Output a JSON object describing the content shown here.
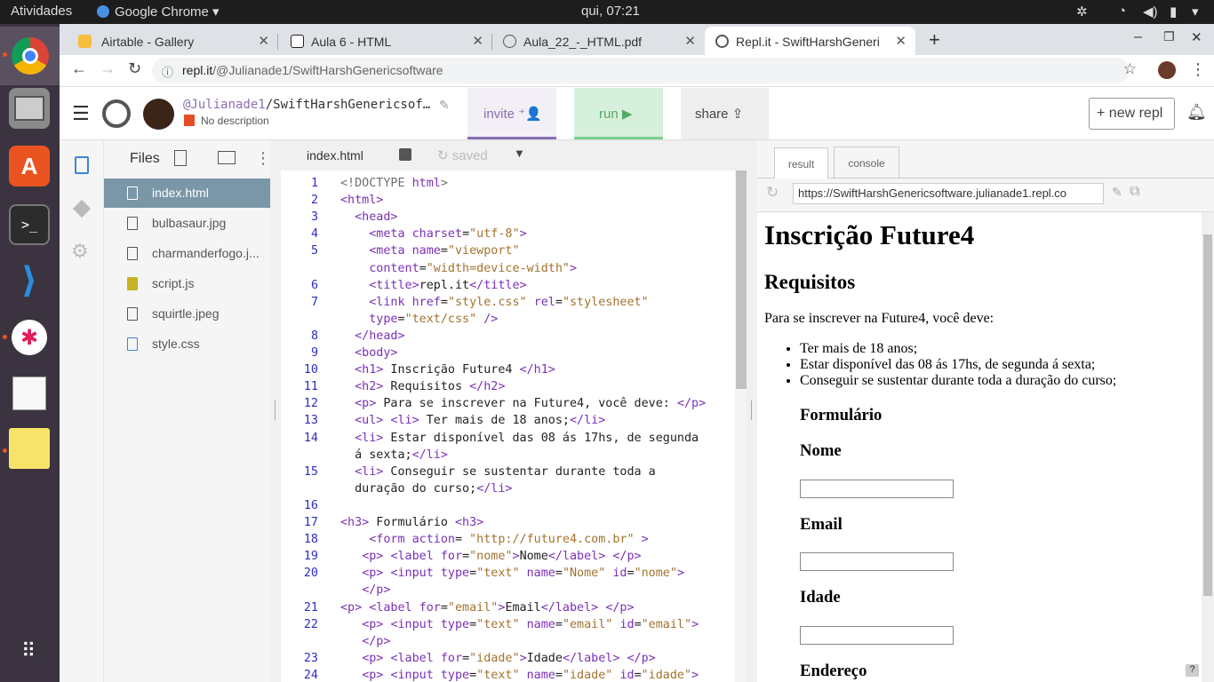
{
  "os": {
    "activities": "Atividades",
    "app_menu": "Google Chrome",
    "clock": "qui, 07:21"
  },
  "browser": {
    "tabs": [
      {
        "label": "Airtable - Gallery",
        "color": "#f7bd3d"
      },
      {
        "label": "Aula 6 - HTML",
        "color": "#222"
      },
      {
        "label": "Aula_22_-_HTML.pdf",
        "color": "#555"
      },
      {
        "label": "Repl.it - SwiftHarshGeneri",
        "color": "#555"
      }
    ],
    "close": "✕",
    "new_tab": "+",
    "url_host": "repl.it",
    "url_path": "/@Julianade1/SwiftHarshGenericsoftware"
  },
  "repl": {
    "user": "@Julianade1",
    "project_name": "/SwiftHarshGenericsof…",
    "description": "No description",
    "invite": "invite",
    "run": "run",
    "share": "share",
    "new_repl": "new repl"
  },
  "files": {
    "title": "Files",
    "items": [
      "index.html",
      "bulbasaur.jpg",
      "charmanderfogo.j...",
      "script.js",
      "squirtle.jpeg",
      "style.css"
    ]
  },
  "editor": {
    "tab": "index.html",
    "status": "saved"
  },
  "code": [
    {
      "n": "1",
      "h": "<span class=\"d\">&lt;!DOCTYPE</span> <span class=\"t\">html</span><span class=\"d\">&gt;</span>"
    },
    {
      "n": "2",
      "h": "<span class=\"t\">&lt;html&gt;</span>"
    },
    {
      "n": "3",
      "h": "  <span class=\"t\">&lt;head&gt;</span>"
    },
    {
      "n": "4",
      "h": "    <span class=\"t\">&lt;meta</span> <span class=\"a\">charset</span>=<span class=\"s\">\"utf-8\"</span><span class=\"t\">&gt;</span>"
    },
    {
      "n": "5",
      "h": "    <span class=\"t\">&lt;meta</span> <span class=\"a\">name</span>=<span class=\"s\">\"viewport\"</span>"
    },
    {
      "n": "",
      "h": "    <span class=\"a\">content</span>=<span class=\"s\">\"width=device-width\"</span><span class=\"t\">&gt;</span>"
    },
    {
      "n": "6",
      "h": "    <span class=\"t\">&lt;title&gt;</span>repl.it<span class=\"t\">&lt;/title&gt;</span>"
    },
    {
      "n": "7",
      "h": "    <span class=\"t\">&lt;link</span> <span class=\"a\">href</span>=<span class=\"s\">\"style.css\"</span> <span class=\"a\">rel</span>=<span class=\"s\">\"stylesheet\"</span>"
    },
    {
      "n": "",
      "h": "    <span class=\"a\">type</span>=<span class=\"s\">\"text/css\"</span> <span class=\"t\">/&gt;</span>"
    },
    {
      "n": "8",
      "h": "  <span class=\"t\">&lt;/head&gt;</span>"
    },
    {
      "n": "9",
      "h": "  <span class=\"t\">&lt;body&gt;</span>"
    },
    {
      "n": "10",
      "h": "  <span class=\"t\">&lt;h1&gt;</span> Inscrição Future4 <span class=\"t\">&lt;/h1&gt;</span>"
    },
    {
      "n": "11",
      "h": "  <span class=\"t\">&lt;h2&gt;</span> Requisitos <span class=\"t\">&lt;/h2&gt;</span>"
    },
    {
      "n": "12",
      "h": "  <span class=\"t\">&lt;p&gt;</span> Para se inscrever na Future4, você deve: <span class=\"t\">&lt;/p&gt;</span>"
    },
    {
      "n": "13",
      "h": "  <span class=\"t\">&lt;ul&gt;</span> <span class=\"t\">&lt;li&gt;</span> Ter mais de 18 anos;<span class=\"t\">&lt;/li&gt;</span>"
    },
    {
      "n": "14",
      "h": "  <span class=\"t\">&lt;li&gt;</span> Estar disponível das 08 ás 17hs, de segunda"
    },
    {
      "n": "",
      "h": "  á sexta;<span class=\"t\">&lt;/li&gt;</span>"
    },
    {
      "n": "15",
      "h": "  <span class=\"t\">&lt;li&gt;</span> Conseguir se sustentar durante toda a"
    },
    {
      "n": "",
      "h": "  duração do curso;<span class=\"t\">&lt;/li&gt;</span>"
    },
    {
      "n": "16",
      "h": ""
    },
    {
      "n": "17",
      "h": "<span class=\"t\">&lt;h3&gt;</span> Formulário <span class=\"t\">&lt;h3&gt;</span>"
    },
    {
      "n": "18",
      "h": "    <span class=\"t\">&lt;form</span> <span class=\"a\">action</span>= <span class=\"s\">\"http://future4.com.br\"</span> <span class=\"t\">&gt;</span>"
    },
    {
      "n": "19",
      "h": "   <span class=\"t\">&lt;p&gt;</span> <span class=\"t\">&lt;label</span> <span class=\"a\">for</span>=<span class=\"s\">\"nome\"</span><span class=\"t\">&gt;</span>Nome<span class=\"t\">&lt;/label&gt;</span> <span class=\"t\">&lt;/p&gt;</span>"
    },
    {
      "n": "20",
      "h": "   <span class=\"t\">&lt;p&gt;</span> <span class=\"t\">&lt;input</span> <span class=\"a\">type</span>=<span class=\"s\">\"text\"</span> <span class=\"a\">name</span>=<span class=\"s\">\"Nome\"</span> <span class=\"a\">id</span>=<span class=\"s\">\"nome\"</span><span class=\"t\">&gt;</span>"
    },
    {
      "n": "",
      "h": "   <span class=\"t\">&lt;/p&gt;</span>"
    },
    {
      "n": "21",
      "h": "<span class=\"t\">&lt;p&gt;</span> <span class=\"t\">&lt;label</span> <span class=\"a\">for</span>=<span class=\"s\">\"email\"</span><span class=\"t\">&gt;</span>Email<span class=\"t\">&lt;/label&gt;</span> <span class=\"t\">&lt;/p&gt;</span>"
    },
    {
      "n": "22",
      "h": "   <span class=\"t\">&lt;p&gt;</span> <span class=\"t\">&lt;input</span> <span class=\"a\">type</span>=<span class=\"s\">\"text\"</span> <span class=\"a\">name</span>=<span class=\"s\">\"email\"</span> <span class=\"a\">id</span>=<span class=\"s\">\"email\"</span><span class=\"t\">&gt;</span>"
    },
    {
      "n": "",
      "h": "   <span class=\"t\">&lt;/p&gt;</span>"
    },
    {
      "n": "23",
      "h": "   <span class=\"t\">&lt;p&gt;</span> <span class=\"t\">&lt;label</span> <span class=\"a\">for</span>=<span class=\"s\">\"idade\"</span><span class=\"t\">&gt;</span>Idade<span class=\"t\">&lt;/label&gt;</span> <span class=\"t\">&lt;/p&gt;</span>"
    },
    {
      "n": "24",
      "h": "   <span class=\"t\">&lt;p&gt;</span> <span class=\"t\">&lt;input</span> <span class=\"a\">type</span>=<span class=\"s\">\"text\"</span> <span class=\"a\">name</span>=<span class=\"s\">\"idade\"</span> <span class=\"a\">id</span>=<span class=\"s\">\"idade\"</span><span class=\"t\">&gt;</span>"
    }
  ],
  "result": {
    "tab_result": "result",
    "tab_console": "console",
    "url": "https://SwiftHarshGenericsoftware.julianade1.repl.co",
    "h1": "Inscrição Future4",
    "h2": "Requisitos",
    "p": "Para se inscrever na Future4, você deve:",
    "list": [
      "Ter mais de 18 anos;",
      "Estar disponível das 08 ás 17hs, de segunda á sexta;",
      "Conseguir se sustentar durante toda a duração do curso;"
    ],
    "h3": "Formulário",
    "label_nome": "Nome",
    "label_email": "Email",
    "label_idade": "Idade",
    "label_endereco": "Endereço",
    "help": "?"
  }
}
